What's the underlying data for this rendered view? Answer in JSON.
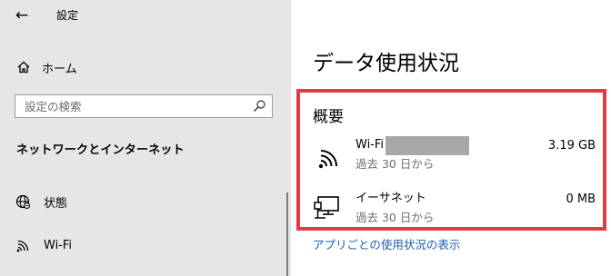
{
  "window": {
    "title": "設定"
  },
  "sidebar": {
    "home_label": "ホーム",
    "search_placeholder": "設定の検索",
    "section_heading": "ネットワークとインターネット",
    "items": [
      {
        "label": "状態",
        "icon": "globe-status-icon"
      },
      {
        "label": "Wi-Fi",
        "icon": "wifi-icon"
      }
    ]
  },
  "main": {
    "page_title": "データ使用状況",
    "overview_heading": "概要",
    "rows": [
      {
        "name": "Wi-Fi",
        "period": "過去 30 日から",
        "usage": "3.19 GB",
        "icon": "wifi-icon"
      },
      {
        "name": "イーサネット",
        "period": "過去 30 日から",
        "usage": "0 MB",
        "icon": "ethernet-icon"
      }
    ],
    "app_usage_link": "アプリごとの使用状況の表示"
  },
  "colors": {
    "sidebar_bg": "#e6e6e6",
    "highlight_border": "#e03c45",
    "link": "#1a5fb4",
    "redaction": "#a8a8a8"
  }
}
